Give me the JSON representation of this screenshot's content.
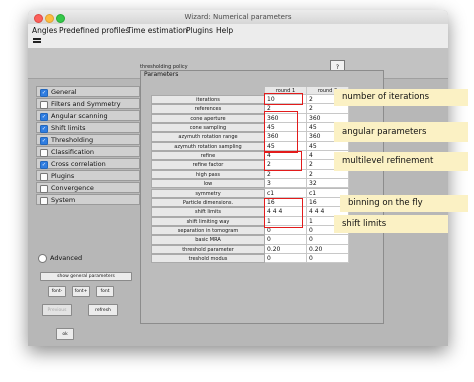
{
  "window": {
    "title": "Wizard: Numerical parameters"
  },
  "menu": [
    "Angles",
    "Predefined profiles",
    "Time estimation",
    "Plugins",
    "Help"
  ],
  "header": {
    "title": "thresholding policy",
    "button_label": "?"
  },
  "sidebar": {
    "items": [
      {
        "label": "General",
        "checked": true
      },
      {
        "label": "Filters and Symmetry",
        "checked": false
      },
      {
        "label": "Angular scanning",
        "checked": true
      },
      {
        "label": "Shift limits",
        "checked": true
      },
      {
        "label": "Thresholding",
        "checked": true
      },
      {
        "label": "Classification",
        "checked": false
      },
      {
        "label": "Cross correlation",
        "checked": true
      },
      {
        "label": "Plugins",
        "checked": false
      },
      {
        "label": "Convergence",
        "checked": false
      },
      {
        "label": "System",
        "checked": false
      }
    ],
    "advanced_label": "Advanced",
    "show_general_label": "show general parameters",
    "font_minus": "font-",
    "font_plus": "font+",
    "font_default": "font",
    "previous_label": "Previous",
    "refresh_label": "refresh",
    "ok_label": "ok"
  },
  "parameters": {
    "panel_label": "Parameters",
    "columns": [
      "round 1",
      "round 2"
    ],
    "rows": [
      {
        "name": "iterations",
        "values": [
          "10",
          "2"
        ]
      },
      {
        "name": "references",
        "values": [
          "2",
          "2"
        ]
      },
      {
        "name": "cone aperture",
        "values": [
          "360",
          "360"
        ]
      },
      {
        "name": "cone sampling",
        "values": [
          "45",
          "45"
        ]
      },
      {
        "name": "azymuth rotation range",
        "values": [
          "360",
          "360"
        ]
      },
      {
        "name": "azymuth rotation sampling",
        "values": [
          "45",
          "45"
        ]
      },
      {
        "name": "refine",
        "values": [
          "4",
          "4"
        ]
      },
      {
        "name": "refine factor",
        "values": [
          "2",
          "2"
        ]
      },
      {
        "name": "high pass",
        "values": [
          "2",
          "2"
        ]
      },
      {
        "name": "low",
        "values": [
          "3",
          "32"
        ]
      },
      {
        "name": "symmetry",
        "values": [
          "c1",
          "c1"
        ]
      },
      {
        "name": "Particle dimensions.",
        "values": [
          "16",
          "16"
        ]
      },
      {
        "name": "shift limits",
        "values": [
          "4 4 4",
          "4 4 4"
        ]
      },
      {
        "name": "shift limiting way",
        "values": [
          "1",
          "1"
        ]
      },
      {
        "name": "separation in tomogram",
        "values": [
          "0",
          "0"
        ]
      },
      {
        "name": "basic MRA",
        "values": [
          "0",
          "0"
        ]
      },
      {
        "name": "threshold parameter",
        "values": [
          "0.20",
          "0.20"
        ]
      },
      {
        "name": "treshold modus",
        "values": [
          "0",
          "0"
        ]
      }
    ]
  },
  "annotations": [
    "number of iterations",
    "angular parameters",
    "multilevel refinement",
    "binning on the fly",
    "shift limits"
  ],
  "colors": {
    "checkbox_blue": "#2f7de1",
    "annotation_red": "#e31b1b",
    "callout_yellow": "#fbf1c4"
  }
}
